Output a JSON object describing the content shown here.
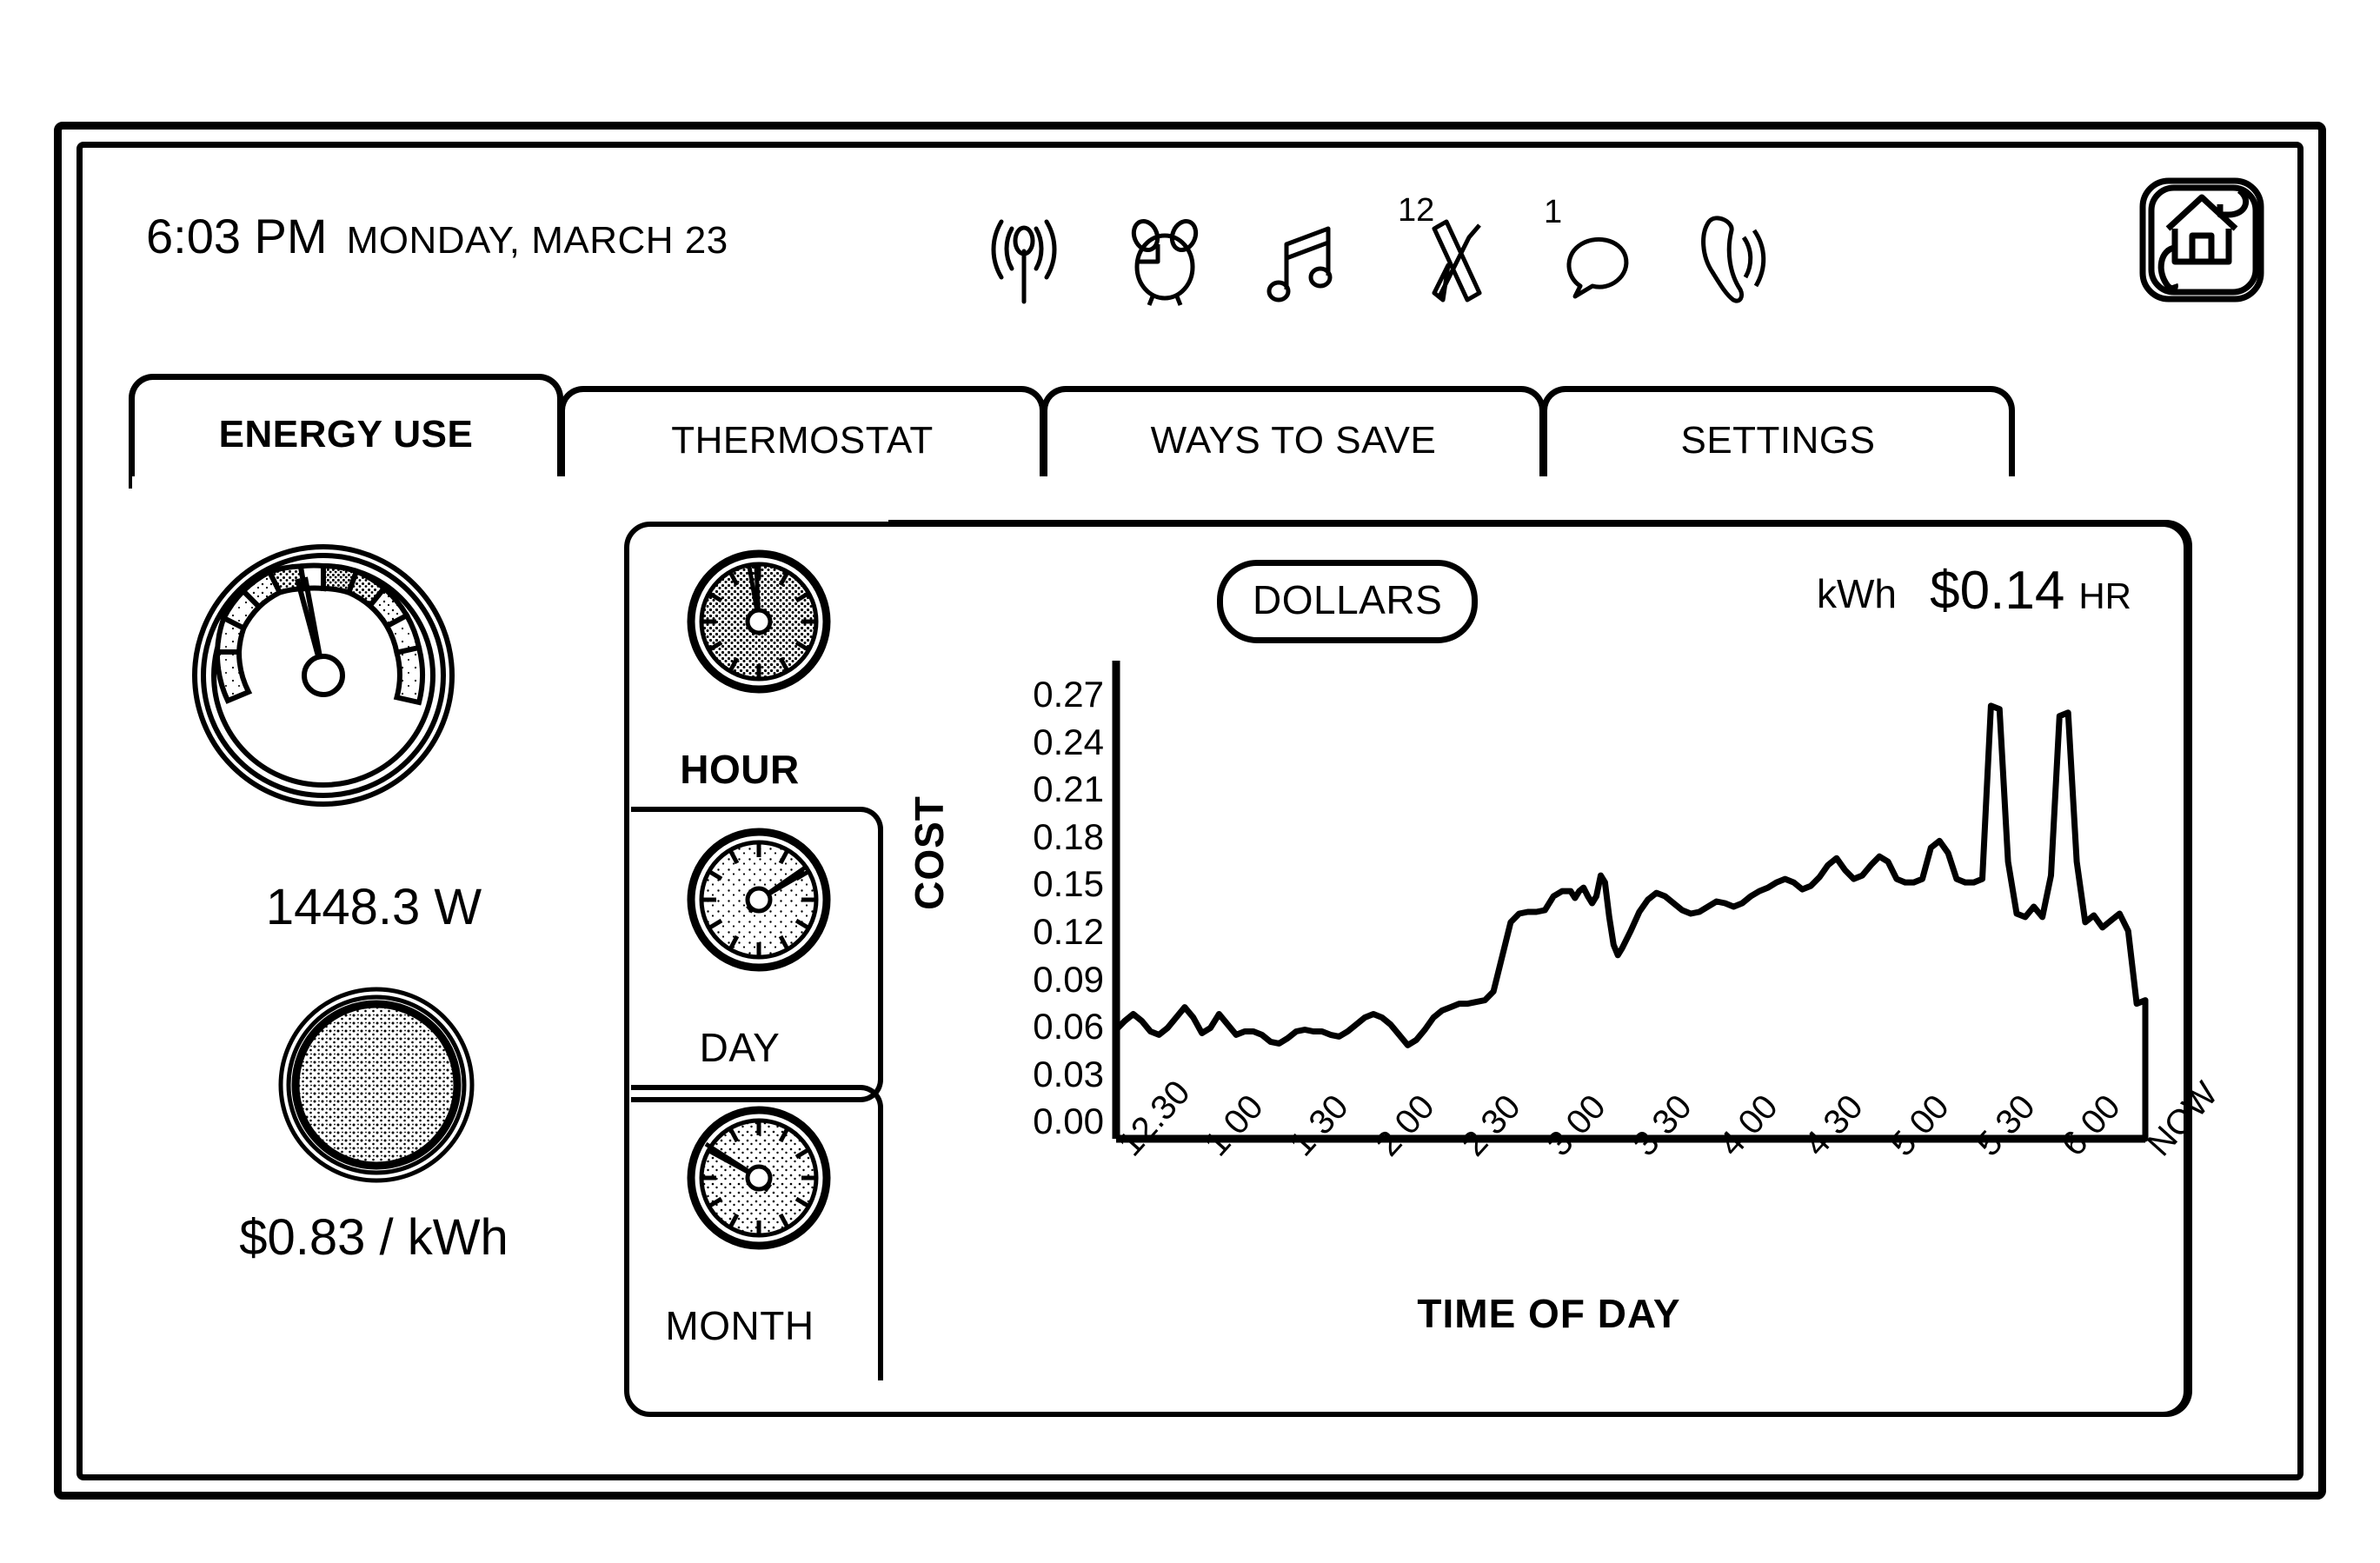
{
  "statusbar": {
    "time": "6:03 PM",
    "date": "MONDAY, MARCH 23",
    "icons": [
      {
        "name": "signal-antenna-icon",
        "badge": ""
      },
      {
        "name": "alarm-clock-icon",
        "badge": ""
      },
      {
        "name": "music-note-icon",
        "badge": ""
      },
      {
        "name": "mail-envelope-icon",
        "badge": "12"
      },
      {
        "name": "speech-bubble-icon",
        "badge": "1"
      },
      {
        "name": "phone-handset-icon",
        "badge": ""
      }
    ],
    "home_button": "home-icon"
  },
  "tabs": [
    {
      "label": "ENERGY USE",
      "active": true
    },
    {
      "label": "THERMOSTAT",
      "active": false
    },
    {
      "label": "WAYS TO SAVE",
      "active": false
    },
    {
      "label": "SETTINGS",
      "active": false
    }
  ],
  "left_panel": {
    "power_gauge_name": "power-meter-gauge",
    "power_value": "1448.3 W",
    "cost_disc_name": "cost-indicator-disc",
    "cost_value": "$0.83 / kWh"
  },
  "period_selector": [
    {
      "label": "HOUR",
      "active": true
    },
    {
      "label": "DAY",
      "active": false
    },
    {
      "label": "MONTH",
      "active": false
    }
  ],
  "chart_header": {
    "dollars_toggle": "DOLLARS",
    "kwh_toggle": "kWh",
    "rate_amount": "$0.14",
    "rate_unit": "HR"
  },
  "chart_data": {
    "type": "line",
    "title": "",
    "xlabel": "TIME OF DAY",
    "ylabel": "COST",
    "ylim": [
      0.0,
      0.27
    ],
    "yticks": [
      "0.27",
      "0.24",
      "0.21",
      "0.18",
      "0.15",
      "0.12",
      "0.09",
      "0.06",
      "0.03",
      "0.00"
    ],
    "xticks": [
      "12.30",
      "1.00",
      "1.30",
      "2.00",
      "2.30",
      "3.00",
      "3.30",
      "4.00",
      "4.30",
      "5.00",
      "5.30",
      "6.00",
      "NOW"
    ],
    "grid": false,
    "legend": "none",
    "series": [
      {
        "name": "Cost",
        "x": [
          0.0,
          0.1,
          0.2,
          0.3,
          0.4,
          0.5,
          0.6,
          0.7,
          0.8,
          0.9,
          1.0,
          1.1,
          1.2,
          1.3,
          1.4,
          1.5,
          1.6,
          1.7,
          1.8,
          1.9,
          2.0,
          2.1,
          2.2,
          2.3,
          2.4,
          2.5,
          2.6,
          2.7,
          2.8,
          2.9,
          3.0,
          3.1,
          3.2,
          3.3,
          3.4,
          3.5,
          3.6,
          3.7,
          3.8,
          3.9,
          4.0,
          4.1,
          4.2,
          4.3,
          4.4,
          4.5,
          4.6,
          4.7,
          4.8,
          4.9,
          5.0,
          5.1,
          5.2,
          5.3,
          5.35,
          5.4,
          5.45,
          5.5,
          5.55,
          5.6,
          5.65,
          5.7,
          5.75,
          5.8,
          5.85,
          5.9,
          6.0,
          6.1,
          6.2,
          6.3,
          6.4,
          6.5,
          6.6,
          6.7,
          6.8,
          6.9,
          7.0,
          7.1,
          7.2,
          7.3,
          7.4,
          7.5,
          7.6,
          7.7,
          7.8,
          7.9,
          8.0,
          8.1,
          8.2,
          8.3,
          8.4,
          8.5,
          8.6,
          8.7,
          8.8,
          8.9,
          9.0,
          9.1,
          9.2,
          9.3,
          9.4,
          9.5,
          9.6,
          9.7,
          9.8,
          9.9,
          10.0,
          10.1,
          10.2,
          10.3,
          10.4,
          10.5,
          10.6,
          10.7,
          10.8,
          10.9,
          11.0,
          11.1,
          11.2,
          11.3,
          11.4,
          11.5,
          11.6,
          11.7,
          11.8,
          11.9,
          12.0
        ],
        "y": [
          0.063,
          0.068,
          0.072,
          0.068,
          0.062,
          0.06,
          0.064,
          0.07,
          0.076,
          0.07,
          0.061,
          0.064,
          0.072,
          0.066,
          0.06,
          0.062,
          0.062,
          0.06,
          0.056,
          0.055,
          0.058,
          0.062,
          0.063,
          0.062,
          0.062,
          0.06,
          0.059,
          0.062,
          0.066,
          0.07,
          0.072,
          0.07,
          0.066,
          0.06,
          0.054,
          0.057,
          0.063,
          0.07,
          0.074,
          0.076,
          0.078,
          0.078,
          0.079,
          0.08,
          0.085,
          0.105,
          0.125,
          0.13,
          0.131,
          0.131,
          0.132,
          0.14,
          0.143,
          0.143,
          0.139,
          0.143,
          0.145,
          0.14,
          0.136,
          0.14,
          0.152,
          0.148,
          0.128,
          0.112,
          0.106,
          0.11,
          0.12,
          0.131,
          0.138,
          0.142,
          0.14,
          0.136,
          0.132,
          0.13,
          0.131,
          0.134,
          0.137,
          0.136,
          0.134,
          0.136,
          0.14,
          0.143,
          0.145,
          0.148,
          0.15,
          0.148,
          0.144,
          0.146,
          0.151,
          0.158,
          0.162,
          0.155,
          0.15,
          0.152,
          0.158,
          0.163,
          0.16,
          0.15,
          0.148,
          0.148,
          0.15,
          0.168,
          0.172,
          0.165,
          0.15,
          0.148,
          0.148,
          0.15,
          0.25,
          0.248,
          0.16,
          0.13,
          0.128,
          0.134,
          0.128,
          0.152,
          0.244,
          0.246,
          0.16,
          0.125,
          0.129,
          0.122,
          0.126,
          0.13,
          0.12,
          0.078,
          0.08
        ]
      }
    ]
  }
}
